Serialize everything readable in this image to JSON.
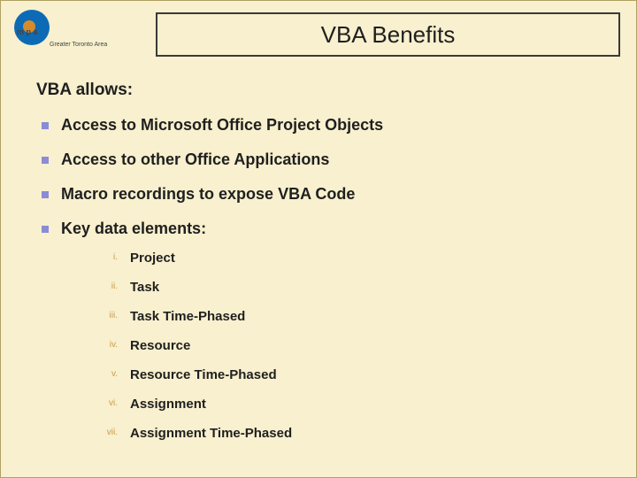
{
  "logo": {
    "text": "m p a",
    "sub": "Greater Toronto Area"
  },
  "title": "VBA Benefits",
  "intro": "VBA allows:",
  "bullets": [
    "Access to Microsoft Office Project Objects",
    "Access to other Office Applications",
    "Macro recordings to expose VBA Code",
    "Key data elements:"
  ],
  "sublist": [
    {
      "r": "i.",
      "t": "Project"
    },
    {
      "r": "ii.",
      "t": "Task"
    },
    {
      "r": "iii.",
      "t": "Task Time-Phased"
    },
    {
      "r": "iv.",
      "t": "Resource"
    },
    {
      "r": "v.",
      "t": "Resource Time-Phased"
    },
    {
      "r": "vi.",
      "t": "Assignment"
    },
    {
      "r": "vii.",
      "t": "Assignment Time-Phased"
    }
  ]
}
